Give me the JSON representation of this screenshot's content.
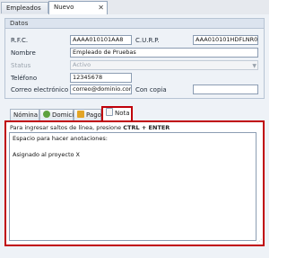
{
  "tabs": [
    {
      "label": "Empleados",
      "active": false
    },
    {
      "label": "Nuevo empleado",
      "active": true
    }
  ],
  "group": {
    "title": "Datos"
  },
  "form": {
    "rfc_label": "R.F.C.",
    "rfc_value": "AAAA010101AA8",
    "curp_label": "C.U.R.P.",
    "curp_value": "AAA010101HDFLNR08",
    "nombre_label": "Nombre",
    "nombre_value": "Empleado de Pruebas",
    "status_label": "Status",
    "status_value": "Activo",
    "telefono_label": "Teléfono",
    "telefono_value": "12345678",
    "correo_label": "Correo electrónico",
    "correo_value": "correo@dominio.com",
    "concopia_label": "Con copia",
    "concopia_value": ""
  },
  "subtabs": [
    {
      "label": "Nómina",
      "icon": "payroll-icon",
      "active": false
    },
    {
      "label": "Domicilio",
      "icon": "globe-icon",
      "active": false
    },
    {
      "label": "Pago",
      "icon": "payment-icon",
      "active": false
    },
    {
      "label": "Nota",
      "icon": "note-icon",
      "active": true
    }
  ],
  "note": {
    "hint_prefix": "Para ingresar saltos de línea, presione",
    "hint_keys": "CTRL + ENTER",
    "lines": [
      "Espacio para hacer anotaciones:",
      "Asignado al proyecto X"
    ]
  },
  "colors": {
    "highlight": "#c0000a",
    "panel": "#eef2f7"
  }
}
